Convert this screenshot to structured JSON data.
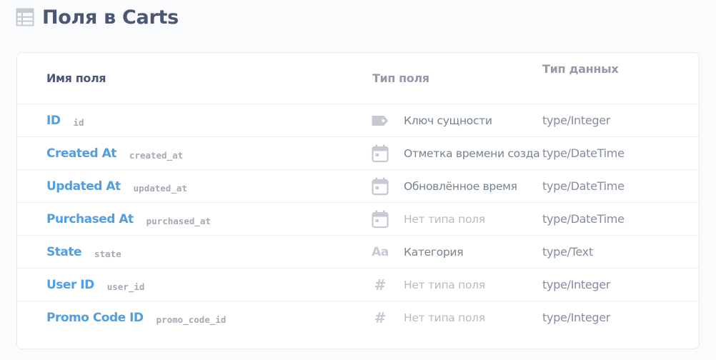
{
  "page": {
    "title": "Поля в Carts",
    "title_icon": "table-icon"
  },
  "table": {
    "headers": {
      "name": "Имя поля",
      "field_type": "Тип поля",
      "data_type": "Тип данных"
    },
    "rows": [
      {
        "display_name": "ID",
        "column_name": "id",
        "semantic_icon": "key-tag-icon",
        "semantic_type": "Ключ сущности",
        "semantic_unset": false,
        "data_type": "type/Integer"
      },
      {
        "display_name": "Created At",
        "column_name": "created_at",
        "semantic_icon": "calendar-icon",
        "semantic_type": "Отметка времени созда",
        "semantic_unset": false,
        "data_type": "type/DateTime"
      },
      {
        "display_name": "Updated At",
        "column_name": "updated_at",
        "semantic_icon": "calendar-icon",
        "semantic_type": "Обновлённое время",
        "semantic_unset": false,
        "data_type": "type/DateTime"
      },
      {
        "display_name": "Purchased At",
        "column_name": "purchased_at",
        "semantic_icon": "calendar-icon",
        "semantic_type": "Нет типа поля",
        "semantic_unset": true,
        "data_type": "type/DateTime"
      },
      {
        "display_name": "State",
        "column_name": "state",
        "semantic_icon": "text-aa-icon",
        "semantic_type": "Категория",
        "semantic_unset": false,
        "data_type": "type/Text"
      },
      {
        "display_name": "User ID",
        "column_name": "user_id",
        "semantic_icon": "number-hash-icon",
        "semantic_type": "Нет типа поля",
        "semantic_unset": true,
        "data_type": "type/Integer"
      },
      {
        "display_name": "Promo Code ID",
        "column_name": "promo_code_id",
        "semantic_icon": "number-hash-icon",
        "semantic_type": "Нет типа поля",
        "semantic_unset": true,
        "data_type": "type/Integer"
      }
    ]
  },
  "colors": {
    "title": "#4c5773",
    "link": "#509ee3",
    "muted": "#949aab",
    "icon": "#c5c9d1",
    "background": "#f9fbfc"
  }
}
